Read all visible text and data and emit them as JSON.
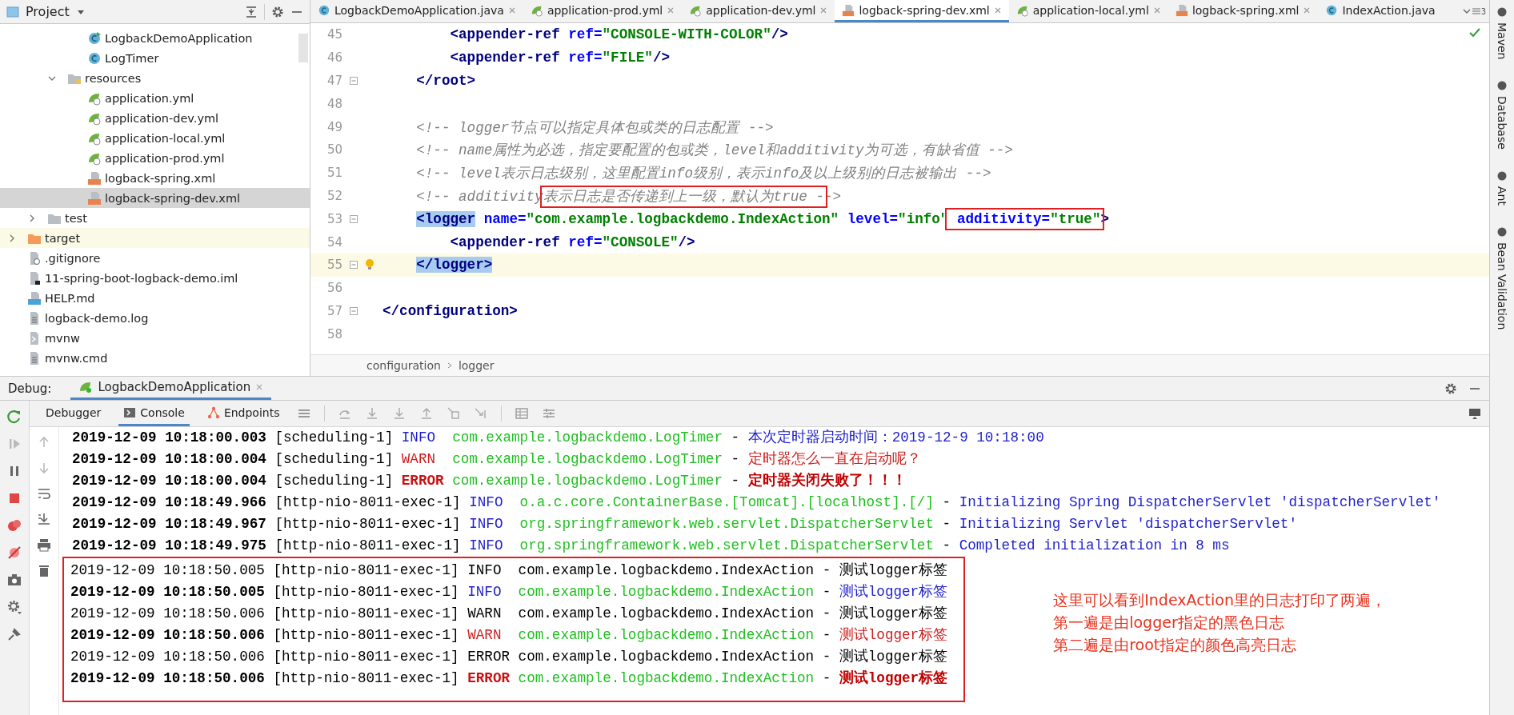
{
  "project": {
    "title": "Project",
    "tree": [
      {
        "children": [
          {
            "children": [
              {
                "children": [
                  {
                    "label": "LogbackDemoApplication",
                    "kind": "class-run",
                    "selected": false,
                    "highlighted": false
                  },
                  {
                    "label": "LogTimer",
                    "kind": "class",
                    "selected": false,
                    "highlighted": false
                  }
                ]
              },
              {
                "label": "resources",
                "kind": "folder-resources",
                "expanded": true,
                "selected": false,
                "highlighted": false,
                "children": [
                  {
                    "label": "application.yml",
                    "kind": "spring",
                    "selected": false,
                    "highlighted": false
                  },
                  {
                    "label": "application-dev.yml",
                    "kind": "spring",
                    "selected": false,
                    "highlighted": false
                  },
                  {
                    "label": "application-local.yml",
                    "kind": "spring",
                    "selected": false,
                    "highlighted": false
                  },
                  {
                    "label": "application-prod.yml",
                    "kind": "spring",
                    "selected": false,
                    "highlighted": false
                  },
                  {
                    "label": "logback-spring.xml",
                    "kind": "xml",
                    "selected": false,
                    "highlighted": false
                  },
                  {
                    "label": "logback-spring-dev.xml",
                    "kind": "xml",
                    "selected": true,
                    "highlighted": false
                  }
                ]
              }
            ]
          },
          {
            "label": "test",
            "kind": "folder",
            "expanded": false,
            "selected": false,
            "highlighted": false
          }
        ]
      },
      {
        "label": "target",
        "kind": "folder-orange",
        "expanded": false,
        "selected": false,
        "highlighted": true
      },
      {
        "label": ".gitignore",
        "kind": "gitignore",
        "selected": false,
        "highlighted": false
      },
      {
        "label": "11-spring-boot-logback-demo.iml",
        "kind": "iml",
        "selected": false,
        "highlighted": false
      },
      {
        "label": "HELP.md",
        "kind": "md",
        "selected": false,
        "highlighted": false
      },
      {
        "label": "logback-demo.log",
        "kind": "log",
        "selected": false,
        "highlighted": false
      },
      {
        "label": "mvnw",
        "kind": "script",
        "selected": false,
        "highlighted": false
      },
      {
        "label": "mvnw.cmd",
        "kind": "text",
        "selected": false,
        "highlighted": false
      }
    ]
  },
  "editor_tabs": [
    {
      "label": "LogbackDemoApplication.java",
      "kind": "class-run",
      "selected": false,
      "closable": true
    },
    {
      "label": "application-prod.yml",
      "kind": "spring",
      "selected": false,
      "closable": true
    },
    {
      "label": "application-dev.yml",
      "kind": "spring",
      "selected": false,
      "closable": true
    },
    {
      "label": "logback-spring-dev.xml",
      "kind": "xml",
      "selected": true,
      "closable": true
    },
    {
      "label": "application-local.yml",
      "kind": "spring",
      "selected": false,
      "closable": true
    },
    {
      "label": "logback-spring.xml",
      "kind": "xml",
      "selected": false,
      "closable": true
    },
    {
      "label": "IndexAction.java",
      "kind": "class",
      "selected": false,
      "closable": false
    }
  ],
  "tab_overflow_count": "3",
  "editor": {
    "lines": [
      {
        "number": "45",
        "kind": "plain",
        "current": false,
        "tokens": [
          {
            "text": "        <appender-ref",
            "kind": "tag"
          },
          {
            "text": " ref=",
            "kind": "attr"
          },
          {
            "text": "\"CONSOLE-WITH-COLOR\"",
            "kind": "value"
          },
          {
            "text": "/>",
            "kind": "tag"
          }
        ]
      },
      {
        "number": "46",
        "kind": "plain",
        "current": false,
        "tokens": [
          {
            "text": "        <appender-ref",
            "kind": "tag"
          },
          {
            "text": " ref=",
            "kind": "attr"
          },
          {
            "text": "\"FILE\"",
            "kind": "value"
          },
          {
            "text": "/>",
            "kind": "tag"
          }
        ]
      },
      {
        "number": "47",
        "kind": "fold",
        "current": false,
        "tokens": [
          {
            "text": "    </root>",
            "kind": "tag"
          }
        ]
      },
      {
        "number": "48",
        "kind": "plain",
        "current": false
      },
      {
        "number": "49",
        "kind": "plain",
        "current": false,
        "tokens": [
          {
            "text": "    <!-- logger节点可以指定具体包或类的日志配置 -->",
            "kind": "comment"
          }
        ]
      },
      {
        "number": "50",
        "kind": "plain",
        "current": false,
        "tokens": [
          {
            "text": "    <!-- name属性为必选，指定要配置的包或类，level和additivity为可选，有缺省值 -->",
            "kind": "comment"
          }
        ]
      },
      {
        "number": "51",
        "kind": "plain",
        "current": false,
        "tokens": [
          {
            "text": "    <!-- level表示日志级别，这里配置info级别，表示info及以上级别的日志被输出 -->",
            "kind": "comment"
          }
        ]
      },
      {
        "number": "52",
        "kind": "plain",
        "current": false,
        "tokens": [
          {
            "text": "    <!-- additivity",
            "kind": "comment"
          },
          {
            "text": "表示日志是否传递到上一级，默认为true -",
            "kind": "comment",
            "boxed": true
          },
          {
            "text": "->",
            "kind": "comment"
          }
        ]
      },
      {
        "number": "53",
        "kind": "fold",
        "current": false,
        "tokens": [
          {
            "text": "    <logger",
            "kind": "tag-match"
          },
          {
            "text": " name=",
            "kind": "attr"
          },
          {
            "text": "\"com.example.logbackdemo.IndexAction\"",
            "kind": "value"
          },
          {
            "text": " level=",
            "kind": "attr"
          },
          {
            "text": "\"info\"",
            "kind": "value"
          },
          {
            "text": " additivity=",
            "kind": "attr",
            "boxed": true
          },
          {
            "text": "\"true\"",
            "kind": "value",
            "boxed": true
          },
          {
            "text": ">",
            "kind": "tag"
          }
        ]
      },
      {
        "number": "54",
        "kind": "plain",
        "current": false,
        "tokens": [
          {
            "text": "        <appender-ref",
            "kind": "tag"
          },
          {
            "text": " ref=",
            "kind": "attr"
          },
          {
            "text": "\"CONSOLE\"",
            "kind": "value"
          },
          {
            "text": "/>",
            "kind": "tag"
          }
        ]
      },
      {
        "number": "55",
        "kind": "fold-bulb",
        "current": true,
        "tokens": [
          {
            "text": "    </logger>",
            "kind": "tag-match"
          }
        ]
      },
      {
        "number": "56",
        "kind": "plain",
        "current": false
      },
      {
        "number": "57",
        "kind": "fold",
        "current": false,
        "tokens": [
          {
            "text": "</configuration>",
            "kind": "tag"
          }
        ]
      },
      {
        "number": "58",
        "kind": "plain",
        "current": false
      }
    ],
    "breadcrumbs": [
      "configuration",
      "logger"
    ]
  },
  "tool_windows": [
    "Maven",
    "Database",
    "Ant",
    "Bean Validation"
  ],
  "debug": {
    "label": "Debug:",
    "session": "LogbackDemoApplication",
    "tabs": [
      {
        "label": "Debugger",
        "kind": "plain",
        "selected": false
      },
      {
        "label": "Console",
        "kind": "console",
        "selected": true
      },
      {
        "label": "Endpoints",
        "kind": "endpoints",
        "selected": false
      }
    ],
    "rows": [
      {
        "timestamp": "2019-12-09 10:18:00.003",
        "thread": "[scheduling-1]",
        "level": "INFO",
        "kind": "info",
        "logger": "com.example.logbackdemo.LogTimer",
        "separator": "-",
        "message": "本次定时器启动时间：2019-12-9 10:18:00",
        "colored": true
      },
      {
        "timestamp": "2019-12-09 10:18:00.004",
        "thread": "[scheduling-1]",
        "level": "WARN",
        "kind": "warn",
        "logger": "com.example.logbackdemo.LogTimer",
        "separator": "-",
        "message": "定时器怎么一直在启动呢？",
        "colored": true
      },
      {
        "timestamp": "2019-12-09 10:18:00.004",
        "thread": "[scheduling-1]",
        "level": "ERROR",
        "kind": "error",
        "logger": "com.example.logbackdemo.LogTimer",
        "separator": "-",
        "message": "定时器关闭失败了！！！",
        "colored": true
      },
      {
        "timestamp": "2019-12-09 10:18:49.966",
        "thread": "[http-nio-8011-exec-1]",
        "level": "INFO",
        "kind": "info",
        "logger": "o.a.c.core.ContainerBase.[Tomcat].[localhost].[/]",
        "separator": "-",
        "message": "Initializing Spring DispatcherServlet 'dispatcherServlet'",
        "colored": true
      },
      {
        "timestamp": "2019-12-09 10:18:49.967",
        "thread": "[http-nio-8011-exec-1]",
        "level": "INFO",
        "kind": "info",
        "logger": "org.springframework.web.servlet.DispatcherServlet",
        "separator": "-",
        "message": "Initializing Servlet 'dispatcherServlet'",
        "colored": true
      },
      {
        "timestamp": "2019-12-09 10:18:49.975",
        "thread": "[http-nio-8011-exec-1]",
        "level": "INFO",
        "kind": "info",
        "logger": "org.springframework.web.servlet.DispatcherServlet",
        "separator": "-",
        "message": "Completed initialization in 8 ms",
        "colored": true
      }
    ],
    "annotated_block": {
      "rows": [
        {
          "timestamp": "2019-12-09 10:18:50.005",
          "thread": "[http-nio-8011-exec-1]",
          "level": "INFO",
          "logger": "com.example.logbackdemo.IndexAction",
          "separator": "-",
          "message": "测试logger标签",
          "colored": false
        },
        {
          "timestamp": "2019-12-09 10:18:50.005",
          "thread": "[http-nio-8011-exec-1]",
          "level": "INFO",
          "kind": "info",
          "logger": "com.example.logbackdemo.IndexAction",
          "separator": "-",
          "message": "测试logger标签",
          "colored": true
        },
        {
          "timestamp": "2019-12-09 10:18:50.006",
          "thread": "[http-nio-8011-exec-1]",
          "level": "WARN",
          "logger": "com.example.logbackdemo.IndexAction",
          "separator": "-",
          "message": "测试logger标签",
          "colored": false
        },
        {
          "timestamp": "2019-12-09 10:18:50.006",
          "thread": "[http-nio-8011-exec-1]",
          "level": "WARN",
          "kind": "warn",
          "logger": "com.example.logbackdemo.IndexAction",
          "separator": "-",
          "message": "测试logger标签",
          "colored": true
        },
        {
          "timestamp": "2019-12-09 10:18:50.006",
          "thread": "[http-nio-8011-exec-1]",
          "level": "ERROR",
          "logger": "com.example.logbackdemo.IndexAction",
          "separator": "-",
          "message": "测试logger标签",
          "colored": false
        },
        {
          "timestamp": "2019-12-09 10:18:50.006",
          "thread": "[http-nio-8011-exec-1]",
          "level": "ERROR",
          "kind": "error",
          "logger": "com.example.logbackdemo.IndexAction",
          "separator": "-",
          "message": "测试logger标签",
          "colored": true
        }
      ],
      "note": [
        "这里可以看到IndexAction里的日志打印了两遍，",
        "第一遍是由logger指定的黑色日志",
        "第二遍是由root指定的颜色高亮日志"
      ]
    }
  }
}
